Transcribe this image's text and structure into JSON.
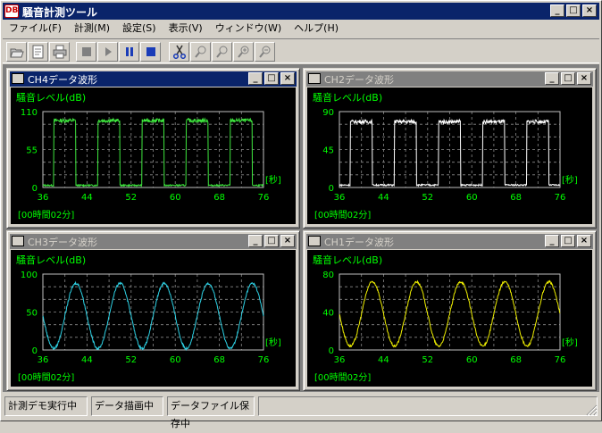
{
  "app": {
    "title": "騒音計測ツール",
    "icon_label": "DB"
  },
  "caption_buttons": {
    "minimize": "_",
    "maximize": "□",
    "close": "×"
  },
  "menu": [
    "ファイル(F)",
    "計測(M)",
    "設定(S)",
    "表示(V)",
    "ウィンドウ(W)",
    "ヘルプ(H)"
  ],
  "toolbar": [
    {
      "name": "open-icon",
      "enabled": true
    },
    {
      "name": "export-csv-icon",
      "enabled": true
    },
    {
      "name": "print-icon",
      "enabled": true
    },
    {
      "name": "record-icon",
      "enabled": false
    },
    {
      "name": "play-icon",
      "enabled": false
    },
    {
      "name": "pause-icon",
      "enabled": true
    },
    {
      "name": "stop-icon",
      "enabled": true
    },
    {
      "name": "cut-icon",
      "enabled": true
    },
    {
      "name": "zoom-x-icon",
      "enabled": false
    },
    {
      "name": "zoom-y-icon",
      "enabled": false
    },
    {
      "name": "zoom-in-icon",
      "enabled": false
    },
    {
      "name": "zoom-out-icon",
      "enabled": false
    }
  ],
  "colors": {
    "ch4": "#3ee63e",
    "ch2": "#ffffff",
    "ch3": "#2ed3e6",
    "ch1": "#f0f000",
    "text_green": "#00ff00",
    "grid": "#8a8a8a"
  },
  "windows": [
    {
      "id": "ch4",
      "title": "CH4データ波形",
      "active": true
    },
    {
      "id": "ch2",
      "title": "CH2データ波形",
      "active": false
    },
    {
      "id": "ch3",
      "title": "CH3データ波形",
      "active": false
    },
    {
      "id": "ch1",
      "title": "CH1データ波形",
      "active": false
    }
  ],
  "chart_data": [
    {
      "type": "line",
      "window": "CH4データ波形",
      "ylabel": "騒音レベル(dB)",
      "xunit": "[秒]",
      "time_label": "[00時間02分]",
      "xlim": [
        36,
        76
      ],
      "xticks": [
        "36",
        "44",
        "52",
        "60",
        "68",
        "76"
      ],
      "ylim": [
        0,
        110
      ],
      "yticks": [
        "0",
        "55",
        "110"
      ],
      "series": [
        {
          "color": "#3ee63e",
          "shape": "square",
          "high": 97,
          "low": 2,
          "period": 8,
          "duty": 0.5,
          "phase": 2
        }
      ],
      "grid": true
    },
    {
      "type": "line",
      "window": "CH2データ波形",
      "ylabel": "騒音レベル(dB)",
      "xunit": "[秒]",
      "time_label": "[00時間02分]",
      "xlim": [
        36,
        76
      ],
      "xticks": [
        "36",
        "44",
        "52",
        "60",
        "68",
        "76"
      ],
      "ylim": [
        0,
        90
      ],
      "yticks": [
        "0",
        "45",
        "90"
      ],
      "series": [
        {
          "color": "#ffffff",
          "shape": "square",
          "high": 78,
          "low": 2,
          "period": 8,
          "duty": 0.5,
          "phase": 2
        }
      ],
      "grid": true
    },
    {
      "type": "line",
      "window": "CH3データ波形",
      "ylabel": "騒音レベル(dB)",
      "xunit": "[秒]",
      "time_label": "[00時間02分]",
      "xlim": [
        36,
        76
      ],
      "xticks": [
        "36",
        "44",
        "52",
        "60",
        "68",
        "76"
      ],
      "ylim": [
        0,
        100
      ],
      "yticks": [
        "0",
        "50",
        "100"
      ],
      "series": [
        {
          "color": "#2ed3e6",
          "shape": "sine",
          "center": 45,
          "amplitude": 43,
          "period": 8,
          "peak_at": 42
        }
      ],
      "grid": true
    },
    {
      "type": "line",
      "window": "CH1データ波形",
      "ylabel": "騒音レベル(dB)",
      "xunit": "[秒]",
      "time_label": "[00時間02分]",
      "xlim": [
        36,
        76
      ],
      "xticks": [
        "36",
        "44",
        "52",
        "60",
        "68",
        "76"
      ],
      "ylim": [
        0,
        80
      ],
      "yticks": [
        "0",
        "40",
        "80"
      ],
      "series": [
        {
          "color": "#f0f000",
          "shape": "sine",
          "center": 38,
          "amplitude": 34,
          "period": 8,
          "peak_at": 42
        }
      ],
      "grid": true
    }
  ],
  "status": {
    "pane1": "計測デモ実行中",
    "pane2": "データ描画中",
    "pane3": "データファイル保存中"
  }
}
